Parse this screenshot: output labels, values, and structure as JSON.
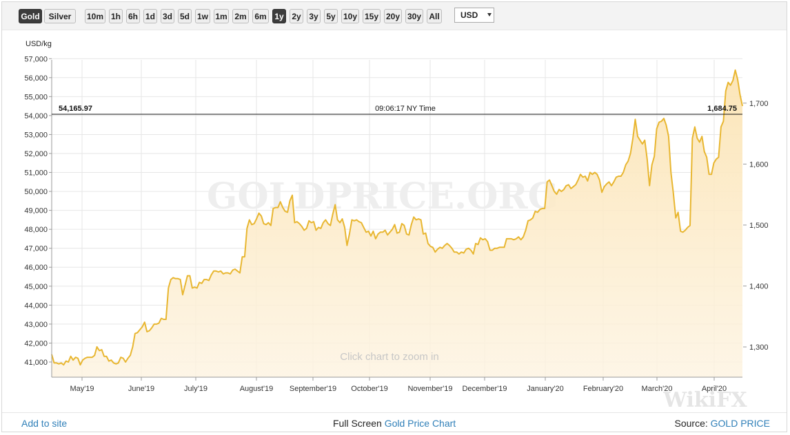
{
  "toolbar": {
    "metal_buttons": [
      {
        "label": "Gold",
        "active": true
      },
      {
        "label": "Silver",
        "active": false
      }
    ],
    "range_buttons": [
      {
        "label": "10m",
        "active": false
      },
      {
        "label": "1h",
        "active": false
      },
      {
        "label": "6h",
        "active": false
      },
      {
        "label": "1d",
        "active": false
      },
      {
        "label": "3d",
        "active": false
      },
      {
        "label": "5d",
        "active": false
      },
      {
        "label": "1w",
        "active": false
      },
      {
        "label": "1m",
        "active": false
      },
      {
        "label": "2m",
        "active": false
      },
      {
        "label": "6m",
        "active": false
      },
      {
        "label": "1y",
        "active": true
      },
      {
        "label": "2y",
        "active": false
      },
      {
        "label": "3y",
        "active": false
      },
      {
        "label": "5y",
        "active": false
      },
      {
        "label": "10y",
        "active": false
      },
      {
        "label": "15y",
        "active": false
      },
      {
        "label": "20y",
        "active": false
      },
      {
        "label": "30y",
        "active": false
      },
      {
        "label": "All",
        "active": false
      }
    ],
    "currency": "USD"
  },
  "chart": {
    "watermark": "GOLDPRICE.ORG",
    "zoom_hint": "Click chart to zoom in",
    "corner_watermark": "WikiFX",
    "crosshair": {
      "left_value": "54,165.97",
      "time": "09:06:17 NY Time",
      "right_value": "1,684.75"
    }
  },
  "chart_data": {
    "type": "area",
    "ylabel": "USD/kg",
    "ylim": [
      40200,
      57300
    ],
    "y_ticks": [
      "41,000",
      "42,000",
      "43,000",
      "44,000",
      "45,000",
      "46,000",
      "47,000",
      "48,000",
      "49,000",
      "50,000",
      "51,000",
      "52,000",
      "53,000",
      "54,000",
      "55,000",
      "56,000",
      "57,000"
    ],
    "y2_ticks": [
      "1,300",
      "1,400",
      "1,500",
      "1,600",
      "1,700"
    ],
    "x_labels": [
      "May'19",
      "June'19",
      "July'19",
      "August'19",
      "September'19",
      "October'19",
      "November'19",
      "December'19",
      "January'20",
      "February'20",
      "March'20",
      "April'20"
    ],
    "series": [
      {
        "values": [
          41400,
          40950,
          40950,
          40900,
          40950,
          40850,
          41050,
          41000,
          41300,
          41100,
          41250,
          41200,
          40850,
          41100,
          41200,
          41250,
          41250,
          41250,
          41350,
          41800,
          41600,
          41650,
          41300,
          41300,
          41050,
          41100,
          40950,
          40900,
          40950,
          41250,
          41200,
          41000,
          41200,
          41350,
          41800,
          42500,
          42550,
          42700,
          42850,
          43100,
          42600,
          42650,
          42800,
          43000,
          43000,
          43050,
          43300,
          43250,
          43250,
          44900,
          45350,
          45450,
          45400,
          45400,
          45350,
          44550,
          45050,
          45550,
          45550,
          44900,
          44950,
          44900,
          45200,
          45150,
          45350,
          45350,
          45300,
          45600,
          45800,
          45800,
          45750,
          45800,
          45650,
          45700,
          45700,
          45650,
          45850,
          45900,
          45800,
          45700,
          46550,
          46550,
          48050,
          48500,
          48250,
          48300,
          48550,
          48850,
          48700,
          48300,
          48250,
          48350,
          48200,
          49100,
          49150,
          49150,
          49450,
          49150,
          48950,
          48900,
          49500,
          49800,
          48350,
          48400,
          48300,
          48150,
          47950,
          48050,
          48450,
          48350,
          48400,
          47950,
          48100,
          48050,
          48350,
          48500,
          48300,
          48200,
          48800,
          49300,
          48500,
          48350,
          48550,
          48100,
          47150,
          47750,
          48500,
          48450,
          48500,
          48400,
          48350,
          48100,
          47850,
          47900,
          47650,
          47900,
          47500,
          47750,
          47850,
          47850,
          47950,
          47700,
          47850,
          48000,
          48250,
          47800,
          47850,
          48300,
          48200,
          47750,
          47700,
          48250,
          48650,
          48500,
          48550,
          48500,
          47750,
          47800,
          47250,
          47100,
          47050,
          46800,
          46950,
          47050,
          47000,
          47150,
          47250,
          47150,
          47000,
          46800,
          46800,
          46700,
          46800,
          46750,
          46950,
          47000,
          46900,
          46700,
          47250,
          47200,
          47550,
          47450,
          47500,
          47350,
          46900,
          46900,
          47000,
          47000,
          47050,
          47050,
          47050,
          47500,
          47500,
          47500,
          47450,
          47500,
          47600,
          47450,
          47600,
          47950,
          48450,
          48500,
          48600,
          48950,
          48900,
          49050,
          49100,
          49100,
          50500,
          50600,
          50300,
          50000,
          49850,
          50100,
          50000,
          50100,
          50300,
          50350,
          50150,
          50250,
          50350,
          50600,
          50900,
          50750,
          50800,
          50550,
          51000,
          50900,
          51000,
          50900,
          50600,
          49950,
          50250,
          50400,
          50500,
          50300,
          50500,
          50750,
          50800,
          50800,
          51000,
          51400,
          51600,
          52000,
          52800,
          53800,
          52900,
          52700,
          52500,
          52700,
          51700,
          50300,
          51400,
          51850,
          53300,
          53650,
          53700,
          53850,
          53500,
          52900,
          51000,
          49900,
          48600,
          48900,
          47900,
          47850,
          47950,
          48100,
          48200,
          52800,
          53400,
          52800,
          52600,
          52900,
          52100,
          51800,
          50900,
          50900,
          51500,
          51700,
          51800,
          53400,
          53700,
          55300,
          55750,
          55600,
          55850,
          56400,
          55900,
          55100,
          54500
        ]
      }
    ]
  },
  "footer": {
    "add_to_site": "Add to site",
    "full_screen": "Full Screen",
    "chart_link": "Gold Price Chart",
    "source_label": "Source:",
    "source_link": "GOLD PRICE"
  }
}
